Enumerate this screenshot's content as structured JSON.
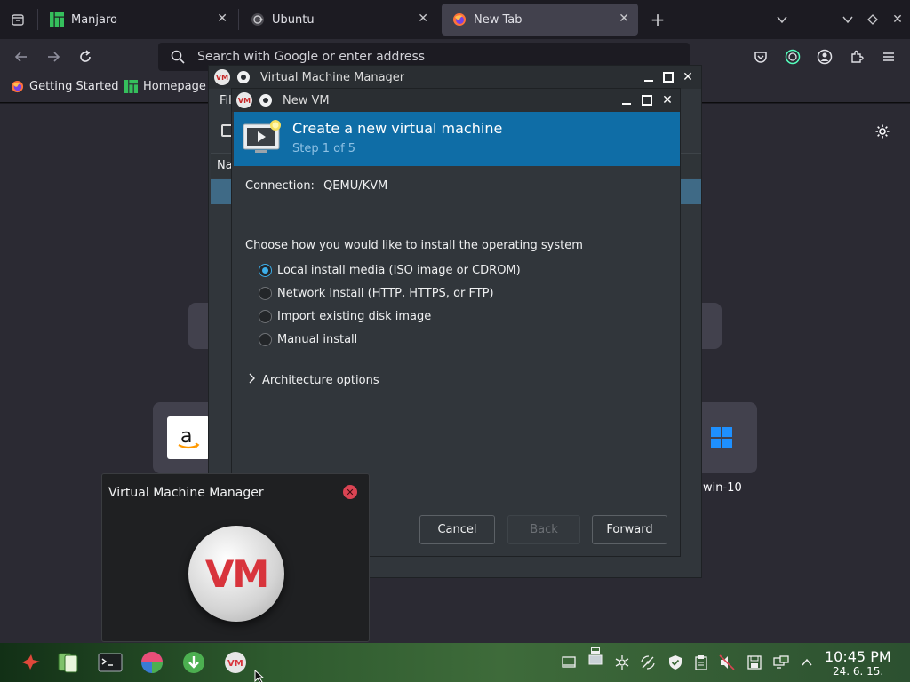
{
  "browser": {
    "tabs": [
      {
        "label": "Manjaro",
        "icon": "manjaro-icon",
        "active": false
      },
      {
        "label": "Ubuntu",
        "icon": "ubuntu-icon",
        "active": false
      },
      {
        "label": "New Tab",
        "icon": "firefox-icon",
        "active": true
      }
    ],
    "new_tab_button": "+",
    "url_placeholder": "Search with Google or enter address",
    "bookmarks": [
      {
        "label": "Getting Started",
        "icon": "firefox-icon"
      },
      {
        "label": "Homepage",
        "icon": "manjaro-icon"
      }
    ],
    "shortcuts": [
      {
        "label": "win-10",
        "icon": "windows-icon"
      }
    ]
  },
  "vmm_window": {
    "title": "Virtual Machine Manager",
    "menu_fragment": "Fil",
    "column_fragment": "Na"
  },
  "new_vm_dialog": {
    "title": "New VM",
    "banner_title": "Create a new virtual machine",
    "banner_step": "Step 1 of 5",
    "connection_label": "Connection:",
    "connection_value": "QEMU/KVM",
    "prompt": "Choose how you would like to install the operating system",
    "options": [
      {
        "label": "Local install media (ISO image or CDROM)",
        "selected": true
      },
      {
        "label": "Network Install (HTTP, HTTPS, or FTP)",
        "selected": false
      },
      {
        "label": "Import existing disk image",
        "selected": false
      },
      {
        "label": "Manual install",
        "selected": false
      }
    ],
    "expander_label": "Architecture options",
    "buttons": {
      "cancel": "Cancel",
      "back": "Back",
      "forward": "Forward"
    }
  },
  "notification": {
    "title": "Virtual Machine Manager",
    "logo_text": "VM"
  },
  "taskbar": {
    "clock_time": "10:45 PM",
    "clock_date": "24. 6. 15."
  },
  "colors": {
    "accent": "#3daee9",
    "banner": "#0f6da6",
    "close_red": "#da4453"
  }
}
